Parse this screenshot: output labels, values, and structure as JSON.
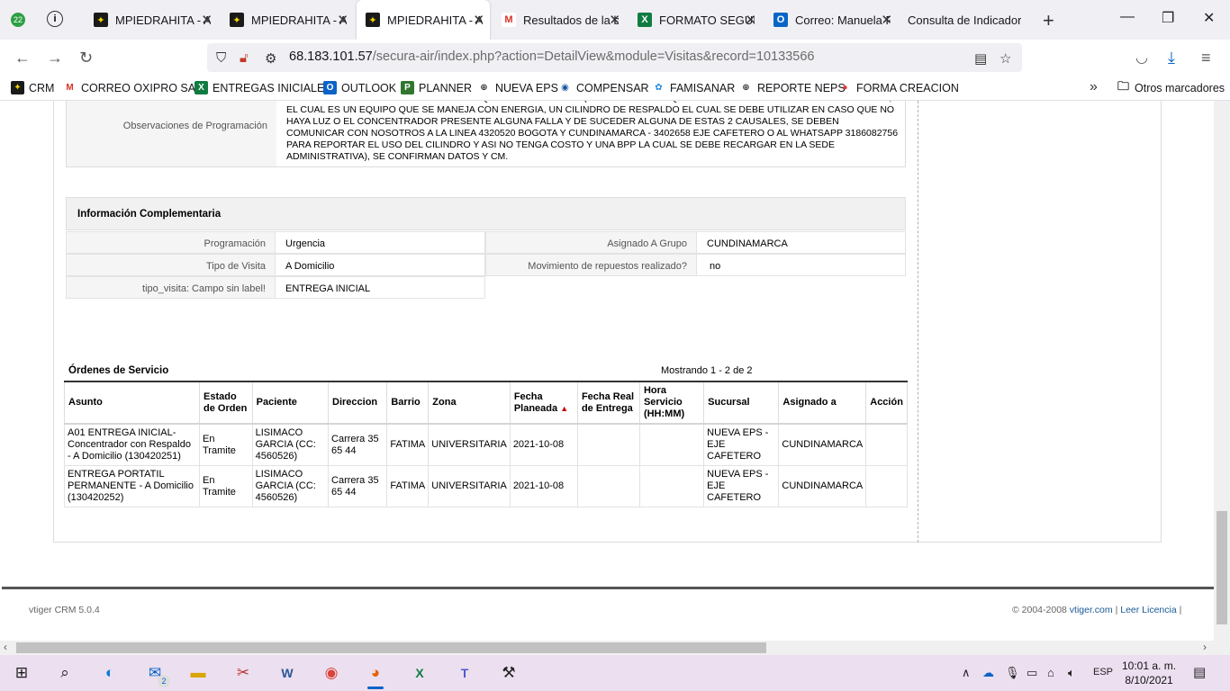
{
  "browser": {
    "tab_counter": "22",
    "tabs": [
      {
        "label": "MPIEDRAHITA - A",
        "icon": "vtiger-icon"
      },
      {
        "label": "MPIEDRAHITA - A",
        "icon": "vtiger-icon"
      },
      {
        "label": "MPIEDRAHITA - A",
        "icon": "vtiger-icon"
      },
      {
        "label": "Resultados de la b",
        "icon": "gmail-icon"
      },
      {
        "label": "FORMATO SEGUIN",
        "icon": "excel-icon"
      },
      {
        "label": "Correo: Manuela F",
        "icon": "outlook-icon"
      },
      {
        "label": "Consulta de Indicador",
        "icon": "blank-icon"
      }
    ],
    "url_host": "68.183.101.57",
    "url_path": "/secura-air/index.php?action=DetailView&module=Visitas&record=10133566",
    "bookmarks": [
      {
        "label": "CRM"
      },
      {
        "label": "CORREO OXIPRO SAS"
      },
      {
        "label": "ENTREGAS INICIALES"
      },
      {
        "label": "OUTLOOK"
      },
      {
        "label": "PLANNER"
      },
      {
        "label": "NUEVA EPS"
      },
      {
        "label": "COMPENSAR"
      },
      {
        "label": "FAMISANAR"
      },
      {
        "label": "REPORTE NEPS"
      },
      {
        "label": "FORMA CREACION"
      }
    ],
    "other_bookmarks": "Otros marcadores"
  },
  "observaciones": {
    "label": "Observaciones de Programación",
    "value": "PROGRAMA SERVICIO Y SE CONFIRMAN EQUIPOS A ENTREGAR (CONCENTRADOR QUE SERA SU PRINCIPAL FUENTE DE OXIGENO, EL CUAL ES UN EQUIPO QUE SE MANEJA CON ENERGIA, UN CILINDRO DE RESPALDO EL CUAL SE DEBE UTILIZAR EN CASO QUE NO HAYA LUZ O EL CONCENTRADOR PRESENTE ALGUNA FALLA Y DE SUCEDER ALGUNA DE ESTAS 2 CAUSALES, SE DEBEN COMUNICAR CON NOSOTROS A LA LINEA 4320520 BOGOTA Y CUNDINAMARCA - 3402658 EJE CAFETERO O AL WHATSAPP 3186082756 PARA REPORTAR EL USO DEL CILINDRO Y ASI NO TENGA COSTO Y UNA BPP LA CUAL SE DEBE RECARGAR EN LA SEDE ADMINISTRATIVA), SE CONFIRMAN DATOS Y CM."
  },
  "info": {
    "title": "Información Complementaria",
    "programacion_label": "Programación",
    "programacion_value": "Urgencia",
    "asignado_label": "Asignado A Grupo",
    "asignado_value": "CUNDINAMARCA",
    "tipo_label": "Tipo de Visita",
    "tipo_value": "A Domicilio",
    "repuestos_label": "Movimiento de repuestos realizado?",
    "repuestos_value": "no",
    "tipo_visita_label": "tipo_visita: Campo sin label!",
    "tipo_visita_value": "ENTREGA INICIAL"
  },
  "ordenes": {
    "title": "Órdenes de Servicio",
    "count": "Mostrando 1 - 2 de 2",
    "headers": {
      "asunto": "Asunto",
      "estado_1": "Estado",
      "estado_2": "de Orden",
      "paciente": "Paciente",
      "direccion": "Direccion",
      "barrio": "Barrio",
      "zona": "Zona",
      "fecha_p_1": "Fecha",
      "fecha_p_2": "Planeada",
      "fecha_r_1": "Fecha Real",
      "fecha_r_2": "de Entrega",
      "hora_1": "Hora",
      "hora_2": "Servicio",
      "hora_3": "(HH:MM)",
      "sucursal": "Sucursal",
      "asignado": "Asignado a",
      "accion": "Acción"
    },
    "rows": [
      {
        "asunto": "A01 ENTREGA INICIAL- Concentrador con Respaldo - A Domicilio (130420251)",
        "estado": "En Tramite",
        "paciente": "LISIMACO GARCIA (CC: 4560526)",
        "direccion": "Carrera 35 65 44",
        "barrio": "FATIMA",
        "zona": "UNIVERSITARIA",
        "fecha_planeada": "2021-10-08",
        "fecha_real": "",
        "hora": "",
        "sucursal": "NUEVA EPS - EJE CAFETERO",
        "asignado": "CUNDINAMARCA",
        "accion": ""
      },
      {
        "asunto": "ENTREGA PORTATIL PERMANENTE - A Domicilio (130420252)",
        "estado": "En Tramite",
        "paciente": "LISIMACO GARCIA (CC: 4560526)",
        "direccion": "Carrera 35 65 44",
        "barrio": "FATIMA",
        "zona": "UNIVERSITARIA",
        "fecha_planeada": "2021-10-08",
        "fecha_real": "",
        "hora": "",
        "sucursal": "NUEVA EPS - EJE CAFETERO",
        "asignado": "CUNDINAMARCA",
        "accion": ""
      }
    ]
  },
  "footer": {
    "version": "vtiger CRM 5.0.4",
    "copyright": "© 2004-2008",
    "vtiger_link": "vtiger.com",
    "sep1": "|",
    "license_link": "Leer Licencia",
    "sep2": "|"
  },
  "taskbar": {
    "mail_badge": "2",
    "language": "ESP",
    "time": "10:01 a. m.",
    "date": "8/10/2021"
  }
}
